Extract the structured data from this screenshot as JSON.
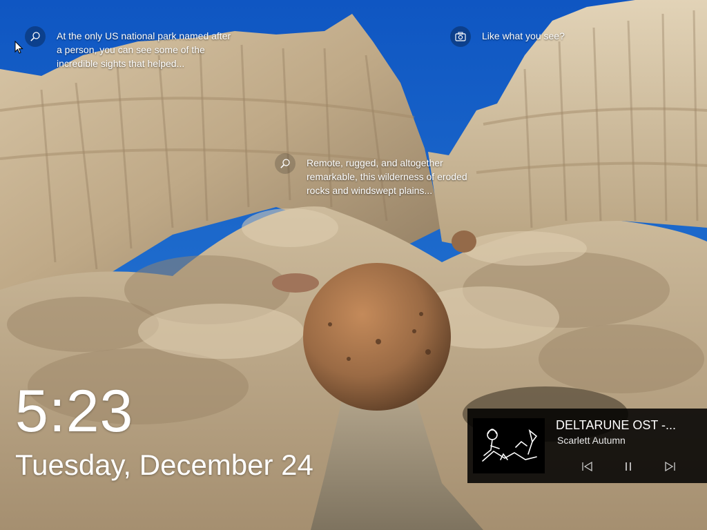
{
  "lock_screen": {
    "time": "5:23",
    "date": "Tuesday, December 24"
  },
  "spotlight": {
    "hint_1": "At the only US national park named after\na person, you can see some of the\nincredible sights that helped...",
    "hint_2": "Like what you see?",
    "hint_3": "Remote, rugged, and altogether\nremarkable, this wilderness of eroded\nrocks and windswept plains..."
  },
  "media": {
    "title": "DELTARUNE OST -...",
    "artist": "Scarlett Autumn",
    "controls": [
      "previous-track",
      "pause",
      "next-track"
    ]
  },
  "icons": {
    "hint_1": "search-icon",
    "hint_2": "camera-icon",
    "hint_3": "search-icon"
  },
  "colors": {
    "sky": "#1a63c8",
    "rock": "#c9b597",
    "boulder": "#a7734b",
    "media_panel": "#000000"
  }
}
